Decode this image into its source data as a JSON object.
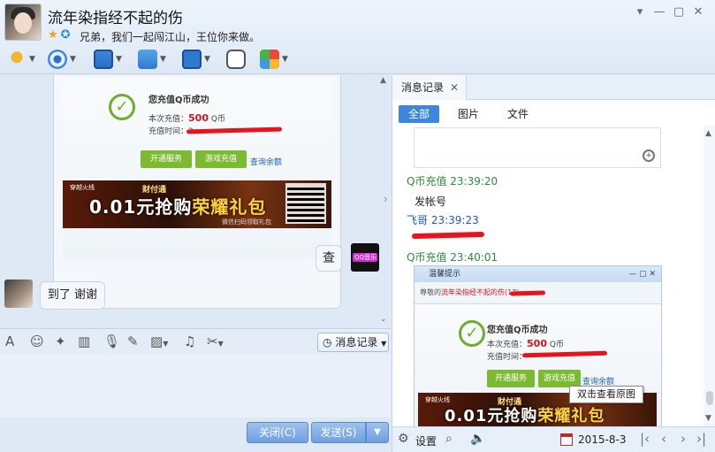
{
  "header": {
    "nickname": "流年染指经不起的伤",
    "signature": "兄弟，我们一起闯江山，王位你来做。",
    "window_buttons": [
      "▾",
      "—",
      "▢",
      "✕"
    ]
  },
  "chat": {
    "receipt": {
      "title": "您充值Q币成功",
      "amount_label": "本次充值：",
      "amount_value": "500",
      "amount_unit": "Q币",
      "time_label": "充值时间：",
      "time_value": "2",
      "btn_service": "开通服务",
      "btn_game": "游戏充值",
      "link_balance": "查询余额",
      "banner_logo": "穿越火线",
      "banner_sub": "财付通",
      "banner_text_a": "0.01元抢购",
      "banner_text_b": "荣耀礼包",
      "banner_note": "微信扫码领取礼包"
    },
    "my_message": "查",
    "my_avatar_text": "QQ音乐",
    "friend_message": "到了 谢谢"
  },
  "format_toolbar": {
    "message_record_label": "消息记录"
  },
  "bottom": {
    "close_label": "关闭(C)",
    "send_label": "发送(S)",
    "send_dropdown": "▼"
  },
  "panel": {
    "tab_label": "消息记录",
    "tab_close": "✕",
    "subtabs": [
      "全部",
      "图片",
      "文件"
    ],
    "entries": [
      {
        "sender": "Q币充值",
        "time": "23:39:20",
        "body": "发帐号"
      },
      {
        "sender": "飞哥",
        "time": "23:39:23",
        "body": ""
      },
      {
        "sender": "Q币充值",
        "time": "23:40:01",
        "body": ""
      }
    ],
    "screenshot": {
      "title": "温馨提示",
      "greeting_prefix": "尊敬的",
      "greeting_name": "流年染指经不起的伤(17",
      "greeting_suffix": "):"
    },
    "tooltip": "双击查看原图",
    "settings_label": "设置",
    "date": "2015-8-3"
  }
}
